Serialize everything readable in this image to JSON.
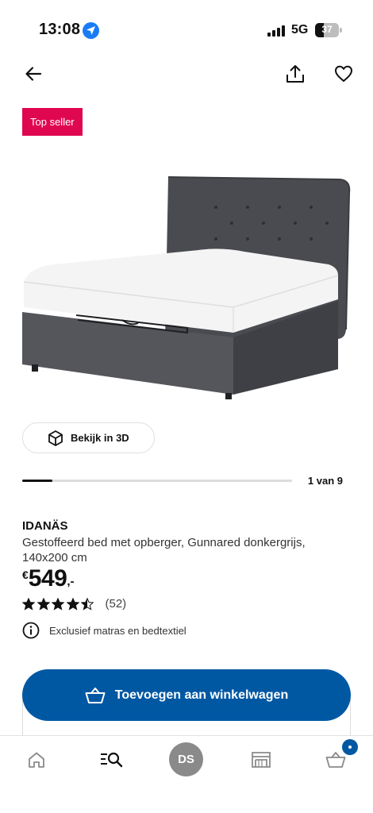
{
  "status_bar": {
    "time": "13:08",
    "network": "5G",
    "battery": "37",
    "battery_level": 0.37,
    "icons": [
      "location-icon",
      "signal-icon",
      "battery-icon"
    ]
  },
  "header": {
    "icons": [
      "arrow-left-icon",
      "share-icon",
      "heart-icon"
    ]
  },
  "badge": {
    "label": "Top seller",
    "color": "#e00751"
  },
  "gallery": {
    "view_3d_label": "Bekijk in 3D",
    "page_indicator": "1 van 9",
    "current": 1,
    "total": 9
  },
  "product": {
    "name": "IDANÄS",
    "description": "Gestoffeerd bed met opberger, Gunnared donkergrijs, 140x200 cm",
    "price": {
      "currency": "€",
      "amount": "549",
      "decimals": ",-"
    },
    "rating": {
      "value": 4.5,
      "max": 5,
      "count": "(52)"
    },
    "notice": "Exclusief matras en bedtextiel"
  },
  "cta": {
    "add_to_cart_label": "Toevoegen aan winkelwagen",
    "color": "#0058a3"
  },
  "tab_bar": {
    "avatar_initials": "DS",
    "tabs": [
      "home-icon",
      "search-icon",
      "avatar",
      "store-icon",
      "cart-icon"
    ]
  }
}
